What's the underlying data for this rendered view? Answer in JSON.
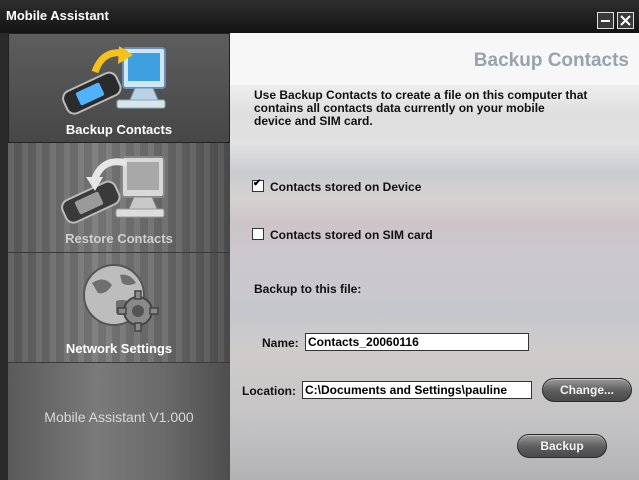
{
  "window": {
    "title": "Mobile Assistant"
  },
  "sidebar": {
    "items": [
      {
        "label": "Backup Contacts",
        "icon": "phone-to-computer-icon"
      },
      {
        "label": "Restore Contacts",
        "icon": "computer-to-phone-icon"
      },
      {
        "label": "Network Settings",
        "icon": "globe-gear-icon"
      }
    ],
    "version": "Mobile Assistant V1.000"
  },
  "content": {
    "title": "Backup Contacts",
    "description": "Use Backup Contacts to create a file on this computer that\ncontains all contacts data currently on  your mobile\ndevice and SIM card.",
    "options": [
      {
        "label": "Contacts stored on Device",
        "checked": true
      },
      {
        "label": "Contacts stored on SIM card",
        "checked": false
      }
    ],
    "section_label": "Backup to this file:",
    "name_label": "Name:",
    "name_value": "Contacts_20060116",
    "location_label": "Location:",
    "location_value": "C:\\Documents and Settings\\pauline",
    "change_button": "Change...",
    "backup_button": "Backup"
  },
  "colors": {
    "title_accent": "#9ba1b0",
    "sidebar_bg": "#6a6a6a",
    "titlebar": "#1c1c1c"
  }
}
